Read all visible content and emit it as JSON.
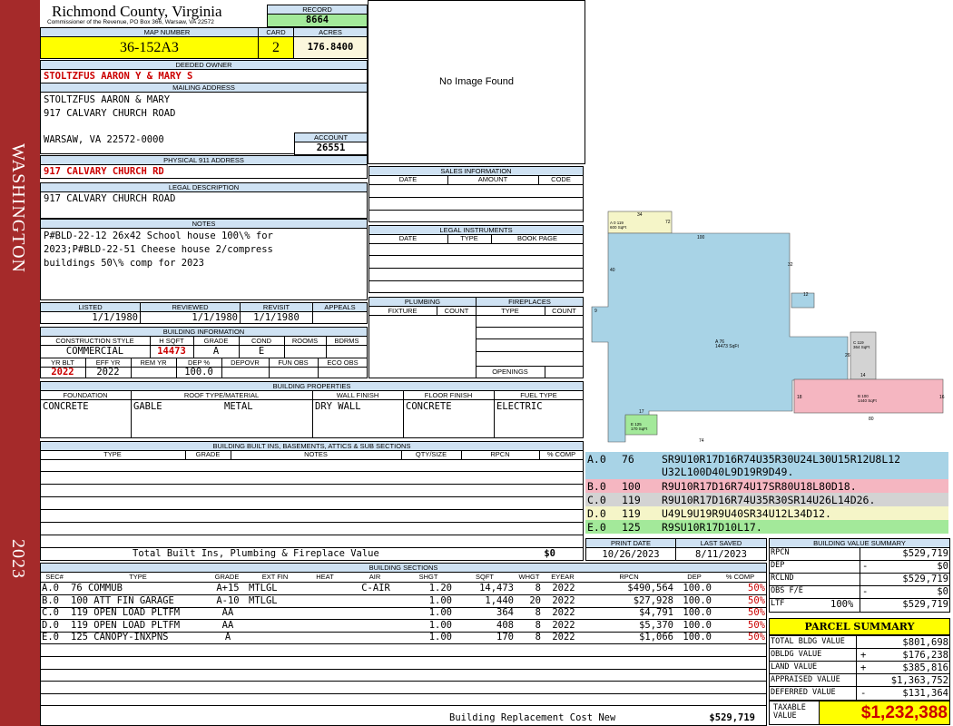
{
  "sidebar": {
    "district": "WASHINGTON",
    "year": "2023"
  },
  "county": {
    "name": "Richmond County, Virginia",
    "subtitle": "Commissioner of the Revenue, PO Box 366, Warsaw, VA 22572"
  },
  "record": {
    "label": "RECORD",
    "value": "8664"
  },
  "map": {
    "label": "MAP NUMBER",
    "value": "36-152A3"
  },
  "card": {
    "label": "CARD",
    "value": "2"
  },
  "acres": {
    "label": "ACRES",
    "value": "176.8400"
  },
  "owner": {
    "label": "DEEDED OWNER",
    "value": "STOLTZFUS AARON Y & MARY S"
  },
  "mailing": {
    "label": "MAILING ADDRESS",
    "line1": "STOLTZFUS AARON & MARY",
    "line2": "917 CALVARY CHURCH ROAD",
    "line3": "WARSAW, VA 22572-0000"
  },
  "account": {
    "label": "ACCOUNT",
    "value": "26551"
  },
  "physical": {
    "label": "PHYSICAL 911 ADDRESS",
    "value": "917 CALVARY CHURCH RD"
  },
  "legal": {
    "label": "LEGAL DESCRIPTION",
    "value": "917 CALVARY CHURCH ROAD"
  },
  "notes": {
    "label": "NOTES",
    "line1": "P#BLD-22-12 26x42 School house 100\\% for",
    "line2": "2023;P#BLD-22-51 Cheese house 2/compress",
    "line3": "buildings 50\\% comp for 2023"
  },
  "dates": {
    "listed_label": "LISTED",
    "listed": "1/1/1980",
    "reviewed_label": "REVIEWED",
    "reviewed": "1/1/1980",
    "revisit_label": "REVISIT",
    "revisit": "1/1/1980",
    "appeals_label": "APPEALS"
  },
  "building_info": {
    "label": "BUILDING INFORMATION",
    "h_style": "CONSTRUCTION STYLE",
    "h_hsqft": "H SQFT",
    "h_grade": "GRADE",
    "h_cond": "COND",
    "h_rooms": "ROOMS",
    "h_bdrms": "BDRMS",
    "style": "COMMERCIAL",
    "hsqft": "14473",
    "grade": "A",
    "cond": "E",
    "h_yrblt": "YR BLT",
    "h_effyr": "EFF YR",
    "h_remyr": "REM YR",
    "h_dep": "DEP %",
    "h_depovr": "DEPOVR",
    "h_funobs": "FUN OBS",
    "h_ecoobs": "ECO OBS",
    "yrblt": "2022",
    "effyr": "2022",
    "dep": "100.0"
  },
  "image": {
    "text": "No Image Found"
  },
  "sales": {
    "label": "SALES INFORMATION",
    "h_date": "DATE",
    "h_amount": "AMOUNT",
    "h_code": "CODE"
  },
  "legal_instr": {
    "label": "LEGAL INSTRUMENTS",
    "h_date": "DATE",
    "h_type": "TYPE",
    "h_book": "BOOK PAGE"
  },
  "plumbing": {
    "label": "PLUMBING",
    "h_fixture": "FIXTURE",
    "h_count": "COUNT"
  },
  "fireplaces": {
    "label": "FIREPLACES",
    "h_type": "TYPE",
    "h_count": "COUNT",
    "openings": "OPENINGS"
  },
  "props": {
    "label": "BUILDING PROPERTIES",
    "h_foundation": "FOUNDATION",
    "h_roof": "ROOF TYPE/MATERIAL",
    "h_wall": "WALL FINISH",
    "h_floor": "FLOOR FINISH",
    "h_fuel": "FUEL TYPE",
    "foundation": "CONCRETE",
    "roof_type": "GABLE",
    "roof_mat": "METAL",
    "wall": "DRY WALL",
    "floor": "CONCRETE",
    "fuel": "ELECTRIC"
  },
  "builtins": {
    "label": "BUILDING BUILT INS, BASEMENTS, ATTICS & SUB SECTIONS",
    "h_type": "TYPE",
    "h_grade": "GRADE",
    "h_notes": "NOTES",
    "h_qty": "QTY/SIZE",
    "h_rpcn": "RPCN",
    "h_comp": "% COMP",
    "total_label": "Total Built Ins, Plumbing & Fireplace Value",
    "total": "$0"
  },
  "sketch": {
    "labels": {
      "top": "34",
      "top_r": "72",
      "top_box": "A 0 119\n600 SqFt",
      "main": "A 76\n14473 SqFt",
      "main_top": "100",
      "right_box": "C 119\n364 SqFt",
      "pink": "B 100\n1440 SqFt",
      "green": "E 125\n170 SqFt",
      "d_label": "D 119",
      "n1": "40",
      "n2": "32",
      "n3": "12",
      "n4": "9",
      "n5": "16",
      "n6": "17",
      "n7": "74",
      "n8": "26",
      "n9": "14",
      "n10": "80",
      "n11": "18"
    },
    "rows": [
      {
        "code": "A.0",
        "num": "76",
        "text": "SR9U10R17D16R74U35R30U24L30U15R12U8L12",
        "text2": "U32L100D40L9D19R9D49.",
        "color": "#a8d3e6"
      },
      {
        "code": "B.0",
        "num": "100",
        "text": "R9U10R17D16R74U17SR80U18L80D18.",
        "text2": "",
        "color": "#f5b6c1"
      },
      {
        "code": "C.0",
        "num": "119",
        "text": "R9U10R17D16R74U35R30SR14U26L14D26.",
        "text2": "",
        "color": "#d3d3d3"
      },
      {
        "code": "D.0",
        "num": "119",
        "text": "U49L9U19R9U40SR34U12L34D12.",
        "text2": "",
        "color": "#f5f5c8"
      },
      {
        "code": "E.0",
        "num": "125",
        "text": "R9SU10R17D10L17.",
        "text2": "",
        "color": "#a3e99a"
      }
    ]
  },
  "print": {
    "print_label": "PRINT DATE",
    "print": "10/26/2023",
    "saved_label": "LAST SAVED",
    "saved": "8/11/2023"
  },
  "sections": {
    "label": "BUILDING SECTIONS",
    "headers": [
      "SEC#",
      "TYPE",
      "GRADE",
      "EXT FIN",
      "HEAT",
      "AIR",
      "SHGT",
      "SQFT",
      "WHGT",
      "EYEAR",
      "RPCN",
      "DEP",
      "% COMP"
    ],
    "rows": [
      [
        "A.0",
        "76 COMMUB",
        "A+15",
        "MTLGL",
        "",
        "C-AIR",
        "1.20",
        "14,473",
        "8",
        "2022",
        "$490,564",
        "100.0",
        "50%"
      ],
      [
        "B.0",
        "100 ATT FIN GARAGE",
        "A-10",
        "MTLGL",
        "",
        "",
        "1.00",
        "1,440",
        "20",
        "2022",
        "$27,928",
        "100.0",
        "50%"
      ],
      [
        "C.0",
        "119 OPEN LOAD PLTFM",
        "AA",
        "",
        "",
        "",
        "1.00",
        "364",
        "8",
        "2022",
        "$4,791",
        "100.0",
        "50%"
      ],
      [
        "D.0",
        "119 OPEN LOAD PLTFM",
        "AA",
        "",
        "",
        "",
        "1.00",
        "408",
        "8",
        "2022",
        "$5,370",
        "100.0",
        "50%"
      ],
      [
        "E.0",
        "125 CANOPY-INXPNS",
        "A",
        "",
        "",
        "",
        "1.00",
        "170",
        "8",
        "2022",
        "$1,066",
        "100.0",
        "50%"
      ]
    ],
    "brcn_label": "Building Replacement Cost New",
    "brcn": "$529,719"
  },
  "value_summary": {
    "label": "BUILDING VALUE SUMMARY",
    "rows": [
      {
        "k": "RPCN",
        "s": "",
        "v": "$529,719"
      },
      {
        "k": "DEP",
        "s": "-",
        "v": "$0"
      },
      {
        "k": "RCLND",
        "s": "",
        "v": "$529,719"
      },
      {
        "k": "OBS F/E",
        "s": "-",
        "v": "$0"
      },
      {
        "k": "LTF",
        "p": "100%",
        "s": "",
        "v": "$529,719"
      }
    ]
  },
  "parcel": {
    "label": "PARCEL SUMMARY",
    "rows": [
      {
        "k": "TOTAL BLDG VALUE",
        "s": "",
        "v": "$801,698"
      },
      {
        "k": "OBLDG VALUE",
        "s": "+",
        "v": "$176,238"
      },
      {
        "k": "LAND VALUE",
        "s": "+",
        "v": "$385,816"
      },
      {
        "k": "APPRAISED VALUE",
        "s": "",
        "v": "$1,363,752"
      },
      {
        "k": "DEFERRED VALUE",
        "s": "-",
        "v": "$131,364"
      }
    ],
    "taxable_label": "TAXABLE VALUE",
    "taxable": "$1,232,388"
  }
}
